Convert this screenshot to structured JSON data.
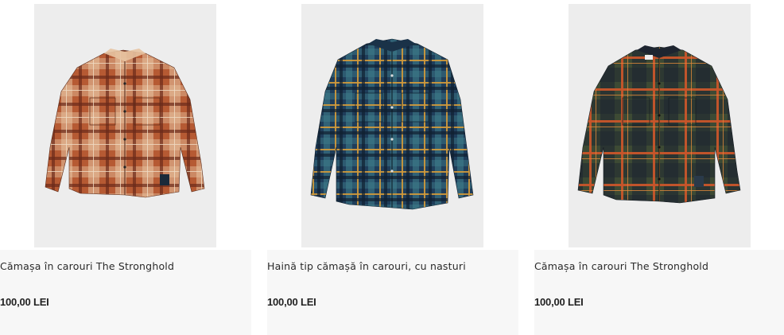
{
  "products": [
    {
      "title": "Cămașa în carouri The Stronghold",
      "price": "100,00 LEI",
      "colors": {
        "base": "#b65a33",
        "stripe1": "#e7c3a1",
        "stripe2": "#6b2a1a",
        "accent": "#f0dcc4"
      }
    },
    {
      "title": "Haină tip cămașă în carouri, cu nasturi",
      "price": "100,00 LEI",
      "colors": {
        "base": "#1f3d5a",
        "stripe1": "#d39a3a",
        "stripe2": "#0f2030",
        "accent": "#3f7f8c"
      }
    },
    {
      "title": "Cămașa în carouri The Stronghold",
      "price": "100,00 LEI",
      "colors": {
        "base": "#3d4a34",
        "stripe1": "#c8552a",
        "stripe2": "#1e2530",
        "accent": "#e0883a"
      }
    }
  ]
}
